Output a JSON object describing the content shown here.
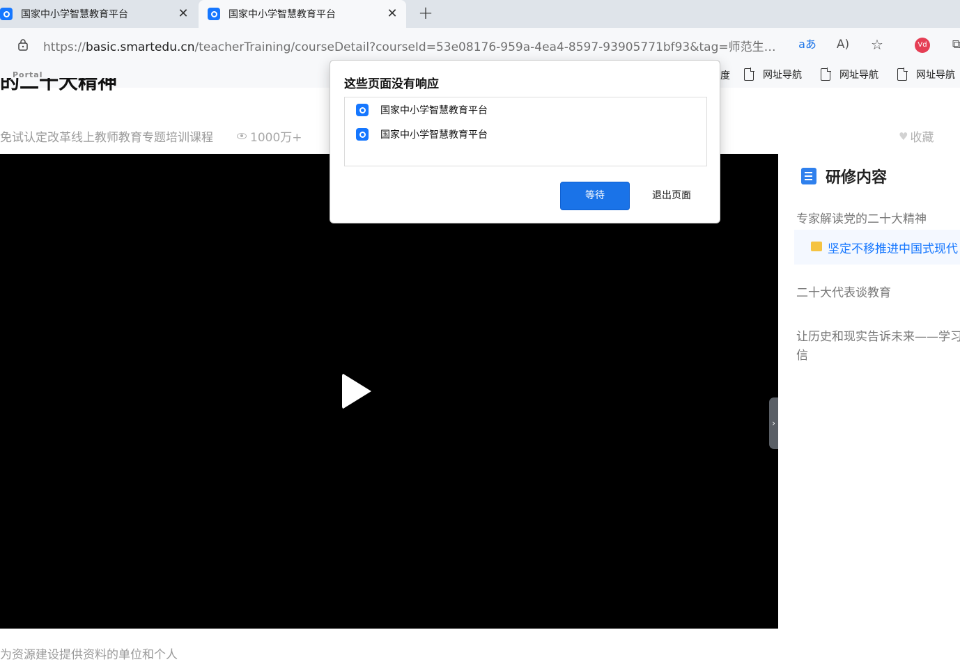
{
  "browser": {
    "tabs": [
      {
        "title": "国家中小学智慧教育平台",
        "active": false
      },
      {
        "title": "国家中小学智慧教育平台",
        "active": true
      }
    ],
    "new_tab_label": "+",
    "close_glyph": "✕",
    "url_scheme": "https://",
    "url_host": "basic.smartedu.cn",
    "url_rest": "/teacherTraining/courseDetail?courseId=53e08176-959a-4ea4-8597-93905771bf93&tag=师范生免试认定改革...",
    "read_mode_label": "aあ",
    "read_aloud_label": "A)",
    "profile_label": "Vd",
    "bookmarks": {
      "logo_text": "Portal",
      "cut_label": "度",
      "items": [
        "网址导航",
        "网址导航",
        "网址导航"
      ]
    }
  },
  "page": {
    "title_cut": "的二十大精神",
    "subline": "免试认定改革线上教师教育专题培训课程",
    "views": "1000万+",
    "favorite_label": "收藏",
    "sidebar": {
      "heading": "研修内容",
      "items": [
        {
          "label": "专家解读党的二十大精神",
          "active": false
        },
        {
          "label": "坚定不移推进中国式现代",
          "active": true
        },
        {
          "label": "二十大代表谈教育",
          "active": false
        },
        {
          "label": "让历史和现实告诉未来——学习",
          "active": false
        },
        {
          "label": "信",
          "active": false
        }
      ]
    },
    "footer_cut": "为资源建设提供资料的单位和个人"
  },
  "dialog": {
    "title": "这些页面没有响应",
    "pages": [
      "国家中小学智慧教育平台",
      "国家中小学智慧教育平台"
    ],
    "wait_label": "等待",
    "exit_label": "退出页面"
  },
  "colors": {
    "accent": "#1a73e8",
    "active_item": "#1677ff",
    "video_bg": "#000000"
  }
}
